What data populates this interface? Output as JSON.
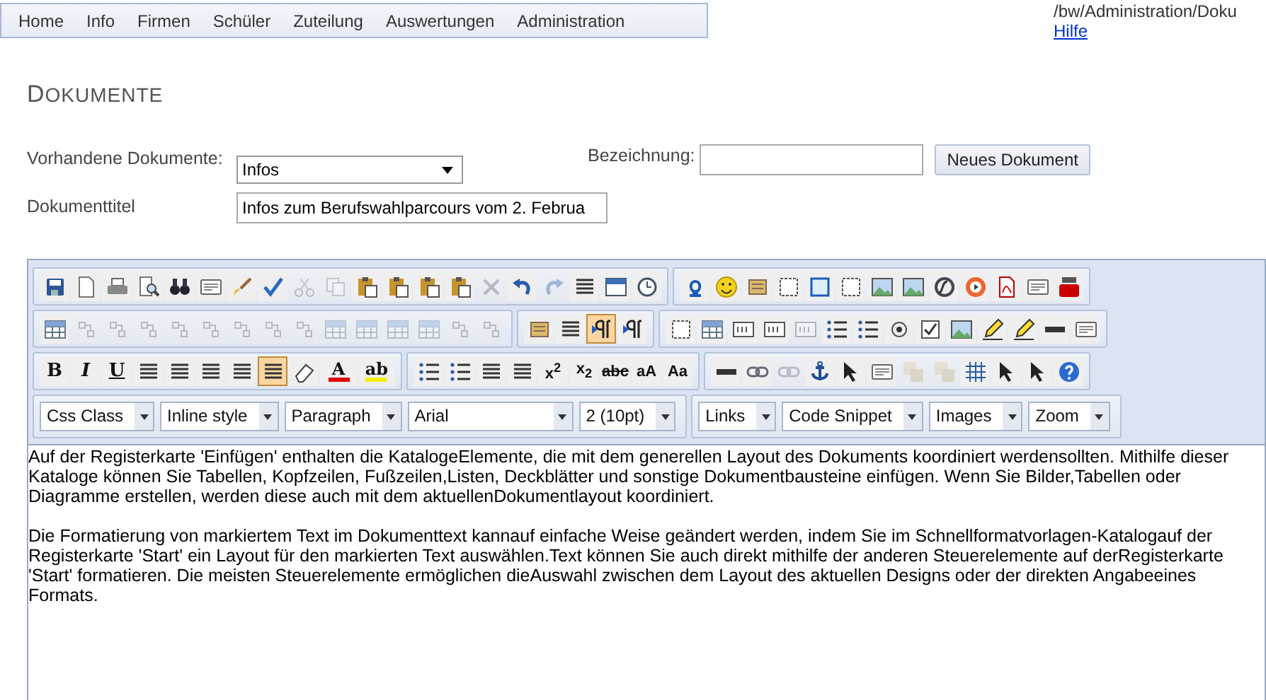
{
  "nav": {
    "items": [
      {
        "label": "Home"
      },
      {
        "label": "Info"
      },
      {
        "label": "Firmen"
      },
      {
        "label": "Schüler"
      },
      {
        "label": "Zuteilung"
      },
      {
        "label": "Auswertungen"
      },
      {
        "label": "Administration"
      }
    ]
  },
  "path": "/bw/Administration/Doku",
  "help_link": "Hilfe",
  "heading": "DOKUMENTE",
  "form": {
    "existing_label": "Vorhandene Dokumente:",
    "existing_value": "Infos",
    "name_label": "Bezeichnung:",
    "new_button": "Neues Dokument",
    "title_label": "Dokumenttitel",
    "title_value": "Infos zum Berufswahlparcours vom 2. Februa"
  },
  "toolbar": [
    [
      {
        "buttons": [
          {
            "kind": "disk",
            "on": false,
            "disabled": false
          },
          {
            "kind": "page",
            "on": false,
            "disabled": false
          },
          {
            "kind": "printer",
            "on": false,
            "disabled": false
          },
          {
            "kind": "preview",
            "on": false,
            "disabled": false
          },
          {
            "kind": "binoculars",
            "on": false,
            "disabled": false
          },
          {
            "kind": "window",
            "on": false,
            "disabled": false
          },
          {
            "kind": "brush",
            "on": false,
            "disabled": false
          },
          {
            "kind": "check",
            "on": false,
            "disabled": false
          },
          {
            "kind": "scissors",
            "on": false,
            "disabled": true
          },
          {
            "kind": "copy",
            "on": false,
            "disabled": true
          },
          {
            "kind": "clipboard",
            "on": false,
            "disabled": false
          },
          {
            "kind": "clipboard",
            "on": false,
            "disabled": false
          },
          {
            "kind": "clipboard",
            "on": false,
            "disabled": false
          },
          {
            "kind": "clipboard",
            "on": false,
            "disabled": false
          },
          {
            "kind": "cross",
            "on": false,
            "disabled": true
          },
          {
            "kind": "undo",
            "on": false,
            "disabled": false
          },
          {
            "kind": "redo",
            "on": false,
            "disabled": true
          },
          {
            "kind": "lines",
            "on": false,
            "disabled": false
          },
          {
            "kind": "calendar",
            "on": false,
            "disabled": false
          },
          {
            "kind": "clock",
            "on": false,
            "disabled": false
          }
        ]
      },
      {
        "buttons": [
          {
            "kind": "horseshoe",
            "on": false,
            "disabled": false
          },
          {
            "kind": "smiley",
            "on": false,
            "disabled": false
          },
          {
            "kind": "tile",
            "on": false,
            "disabled": false
          },
          {
            "kind": "square",
            "on": false,
            "disabled": false
          },
          {
            "kind": "frame",
            "on": false,
            "disabled": false
          },
          {
            "kind": "square",
            "on": false,
            "disabled": false
          },
          {
            "kind": "picture",
            "on": false,
            "disabled": false
          },
          {
            "kind": "picture",
            "on": false,
            "disabled": false
          },
          {
            "kind": "disc",
            "on": false,
            "disabled": false
          },
          {
            "kind": "ring",
            "on": false,
            "disabled": false
          },
          {
            "kind": "pdf",
            "on": false,
            "disabled": false
          },
          {
            "kind": "window",
            "on": false,
            "disabled": false
          },
          {
            "kind": "video",
            "on": false,
            "disabled": false
          }
        ]
      }
    ],
    [
      {
        "buttons": [
          {
            "kind": "table",
            "on": false,
            "disabled": false
          },
          {
            "kind": "tableop",
            "on": false,
            "disabled": true
          },
          {
            "kind": "tableop",
            "on": false,
            "disabled": true
          },
          {
            "kind": "tableop",
            "on": false,
            "disabled": true
          },
          {
            "kind": "tableop",
            "on": false,
            "disabled": true
          },
          {
            "kind": "tableop",
            "on": false,
            "disabled": true
          },
          {
            "kind": "tableop",
            "on": false,
            "disabled": true
          },
          {
            "kind": "tableop",
            "on": false,
            "disabled": true
          },
          {
            "kind": "tableop",
            "on": false,
            "disabled": true
          },
          {
            "kind": "table",
            "on": false,
            "disabled": true
          },
          {
            "kind": "table",
            "on": false,
            "disabled": true
          },
          {
            "kind": "table",
            "on": false,
            "disabled": true
          },
          {
            "kind": "table",
            "on": false,
            "disabled": true
          },
          {
            "kind": "tableop",
            "on": false,
            "disabled": true
          },
          {
            "kind": "tableop",
            "on": false,
            "disabled": true
          }
        ]
      },
      {
        "buttons": [
          {
            "kind": "tile",
            "on": false,
            "disabled": false
          },
          {
            "kind": "lines",
            "on": false,
            "disabled": false
          },
          {
            "kind": "pilcrow",
            "on": true,
            "disabled": false
          },
          {
            "kind": "pilcrow",
            "on": false,
            "disabled": false
          }
        ]
      },
      {
        "buttons": [
          {
            "kind": "square",
            "on": false,
            "disabled": false
          },
          {
            "kind": "table",
            "on": false,
            "disabled": false
          },
          {
            "kind": "textbox",
            "on": false,
            "disabled": false
          },
          {
            "kind": "textbox",
            "on": false,
            "disabled": false
          },
          {
            "kind": "textbox",
            "on": false,
            "disabled": true
          },
          {
            "kind": "list",
            "on": false,
            "disabled": false
          },
          {
            "kind": "list",
            "on": false,
            "disabled": false
          },
          {
            "kind": "radio",
            "on": false,
            "disabled": false
          },
          {
            "kind": "checkbox",
            "on": false,
            "disabled": false
          },
          {
            "kind": "picture",
            "on": false,
            "disabled": false
          },
          {
            "kind": "pencil",
            "on": false,
            "disabled": false
          },
          {
            "kind": "pencil",
            "on": false,
            "disabled": false
          },
          {
            "kind": "bar",
            "on": false,
            "disabled": false
          },
          {
            "kind": "window",
            "on": false,
            "disabled": false
          }
        ]
      }
    ],
    [
      {
        "buttons": [
          {
            "kind": "text",
            "label": "B",
            "on": false,
            "disabled": false
          },
          {
            "kind": "text",
            "label": "I",
            "on": false,
            "disabled": false
          },
          {
            "kind": "text",
            "label": "U",
            "on": false,
            "disabled": false
          },
          {
            "kind": "lines",
            "on": false,
            "disabled": false
          },
          {
            "kind": "lines",
            "on": false,
            "disabled": false
          },
          {
            "kind": "lines",
            "on": false,
            "disabled": false
          },
          {
            "kind": "lines",
            "on": false,
            "disabled": false
          },
          {
            "kind": "lines",
            "on": true,
            "disabled": false
          },
          {
            "kind": "eraser",
            "on": false,
            "disabled": false
          },
          {
            "kind": "textcolor",
            "label": "A",
            "color": "#e00000",
            "on": false,
            "disabled": false
          },
          {
            "kind": "textcolor",
            "label": "ab",
            "color": "#f0f000",
            "on": false,
            "disabled": false
          }
        ]
      },
      {
        "buttons": [
          {
            "kind": "list",
            "on": false,
            "disabled": false
          },
          {
            "kind": "list",
            "on": false,
            "disabled": false
          },
          {
            "kind": "lines",
            "on": false,
            "disabled": false
          },
          {
            "kind": "lines",
            "on": false,
            "disabled": false
          },
          {
            "kind": "text",
            "label": "x$^{2}$",
            "on": false,
            "disabled": false
          },
          {
            "kind": "text",
            "label": "x$_{2}$",
            "on": false,
            "disabled": false
          },
          {
            "kind": "text",
            "label": "abc",
            "on": false,
            "disabled": false
          },
          {
            "kind": "text",
            "label": "aA",
            "on": false,
            "disabled": false
          },
          {
            "kind": "text",
            "label": "Aa",
            "on": false,
            "disabled": false
          }
        ]
      },
      {
        "buttons": [
          {
            "kind": "bar",
            "on": false,
            "disabled": false
          },
          {
            "kind": "chain",
            "on": false,
            "disabled": false
          },
          {
            "kind": "chain",
            "on": false,
            "disabled": true
          },
          {
            "kind": "anchor",
            "on": false,
            "disabled": false
          },
          {
            "kind": "pointer",
            "on": false,
            "disabled": false
          },
          {
            "kind": "window",
            "on": false,
            "disabled": false
          },
          {
            "kind": "layers",
            "on": false,
            "disabled": true
          },
          {
            "kind": "layers",
            "on": false,
            "disabled": true
          },
          {
            "kind": "grid",
            "on": false,
            "disabled": false
          },
          {
            "kind": "pointer",
            "on": false,
            "disabled": false
          },
          {
            "kind": "pointer",
            "on": false,
            "disabled": false
          },
          {
            "kind": "help",
            "on": false,
            "disabled": false
          }
        ]
      }
    ]
  ],
  "dropdowns": [
    [
      {
        "value": "Css Class"
      },
      {
        "value": "Inline style"
      },
      {
        "value": "Paragraph"
      },
      {
        "value": "Arial"
      },
      {
        "value": "2 (10pt)"
      }
    ],
    [
      {
        "value": "Links"
      },
      {
        "value": "Code Snippet"
      },
      {
        "value": "Images"
      },
      {
        "value": "Zoom"
      }
    ]
  ],
  "content": [
    "Auf der Registerkarte 'Einfügen' enthalten die KatalogeElemente, die mit dem generellen Layout des Dokuments koordiniert werdensollten. Mithilfe dieser Kataloge können Sie Tabellen, Kopfzeilen, Fußzeilen,Listen, Deckblätter und sonstige Dokumentbausteine einfügen. Wenn Sie Bilder,Tabellen oder Diagramme erstellen, werden diese auch mit dem aktuellenDokumentlayout koordiniert.",
    "Die Formatierung von markiertem Text im Dokumenttext kannauf einfache Weise geändert werden, indem Sie im Schnellformatvorlagen-Katalogauf der Registerkarte 'Start' ein Layout für den markierten Text auswählen.Text können Sie auch direkt mithilfe der anderen Steuerelemente auf derRegisterkarte 'Start' formatieren. Die meisten Steuerelemente ermöglichen dieAuswahl zwischen dem Layout des aktuellen Designs oder der direkten Angabeeines Formats."
  ]
}
